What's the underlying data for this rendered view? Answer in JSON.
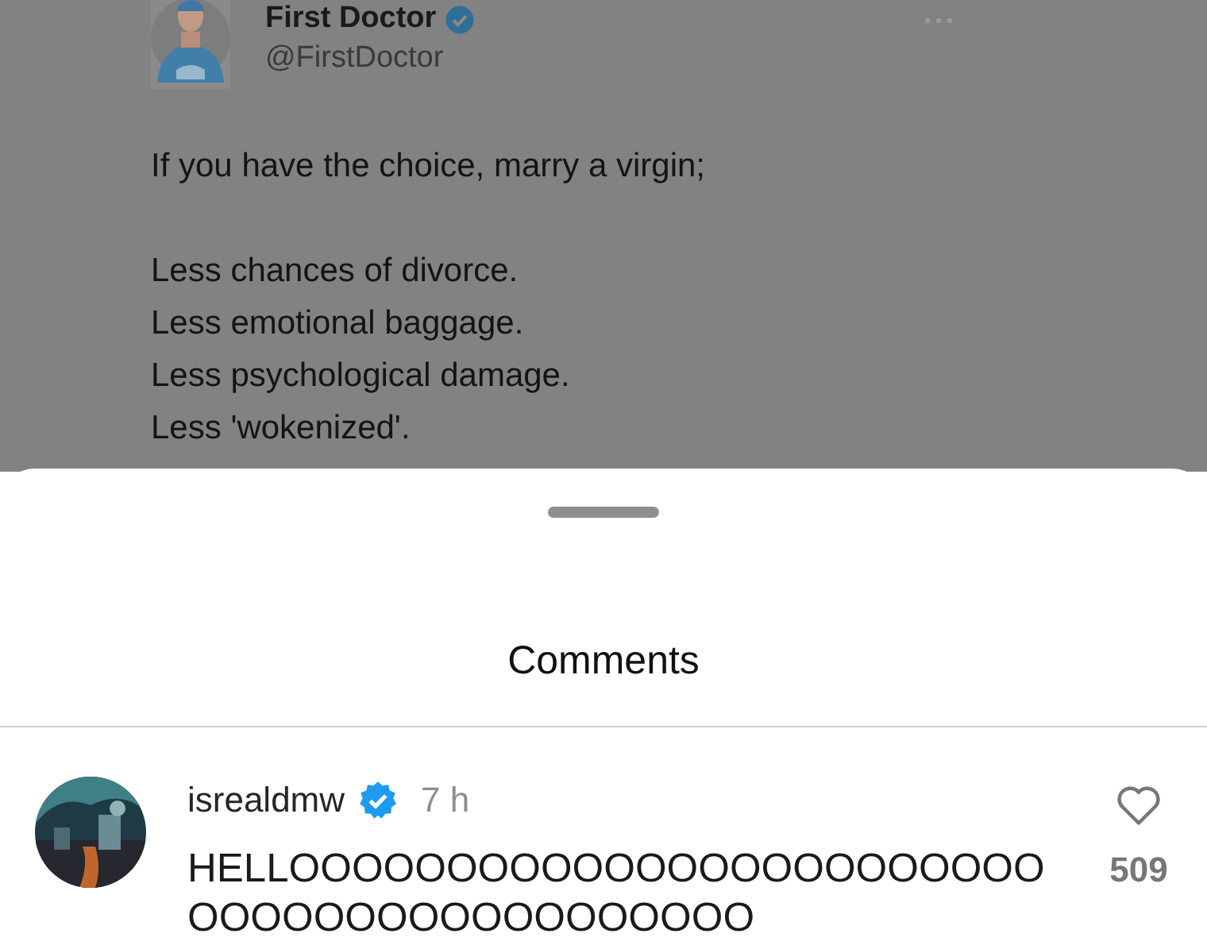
{
  "tweet": {
    "author_name": "First Doctor",
    "verified": true,
    "handle": "@FirstDoctor",
    "paragraphs": [
      [
        "If you have the choice, marry a virgin;"
      ],
      [
        "Less chances of divorce.",
        "Less emotional baggage.",
        "Less psychological damage.",
        "Less 'wokenized'."
      ]
    ]
  },
  "comments_sheet": {
    "title": "Comments",
    "comments": [
      {
        "username": "isrealdmw",
        "verified": true,
        "time": "7 h",
        "text": "HELLOOOOOOOOOOOOOOOOOOOOOOOOOOOOOOOOOOOOOOOOOO",
        "likes": "509",
        "liked": false
      }
    ]
  }
}
